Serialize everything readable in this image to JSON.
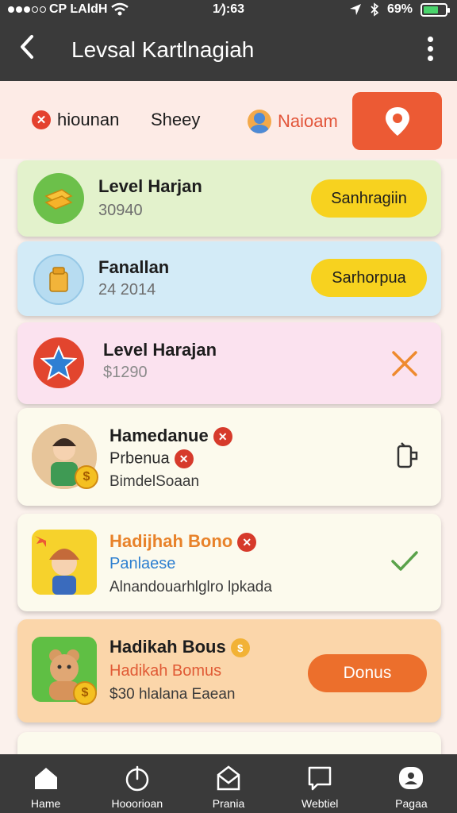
{
  "status_bar": {
    "carrier": "CP ĿAldH",
    "time": "1⁄):63",
    "battery": "69%"
  },
  "header": {
    "title": "Levsal Kartlnagiah"
  },
  "filters": {
    "chip1_label": "hiounan",
    "chip2_label": "Sheey",
    "chip3_label": "Naioam"
  },
  "cards": [
    {
      "title": "Level Harjan",
      "subtitle": "30940",
      "button": "Sanhragiin"
    },
    {
      "title": "Fanallan",
      "subtitle": "24 2014",
      "button": "Sarhorpua"
    },
    {
      "title": "Level Harajan",
      "subtitle": "$1290"
    },
    {
      "title": "Hamedanue",
      "line2": "Prbenua",
      "line3": "BimdelSoaan"
    },
    {
      "title": "Hadijhah Bono",
      "line2": "Panlaese",
      "line3": "Alnandouarhlglro lpkada"
    },
    {
      "title": "Hadikah Bous",
      "line2": "Hadikah Bomus",
      "line3": "$30 hlalana Eaean",
      "button": "Donus"
    }
  ],
  "bottom_nav": [
    {
      "label": "Hame"
    },
    {
      "label": "Hooorioan"
    },
    {
      "label": "Prania"
    },
    {
      "label": "Webtiel"
    },
    {
      "label": "Pagaa"
    }
  ],
  "colors": {
    "card_green": "#e3f2cc",
    "card_blue": "#d3ebf7",
    "card_pink": "#fbe2ef",
    "card_cream": "#fcfaed",
    "card_orange": "#fbd6aa",
    "accent_orange": "#ec5a34",
    "pill_yellow": "#f7d21f"
  }
}
